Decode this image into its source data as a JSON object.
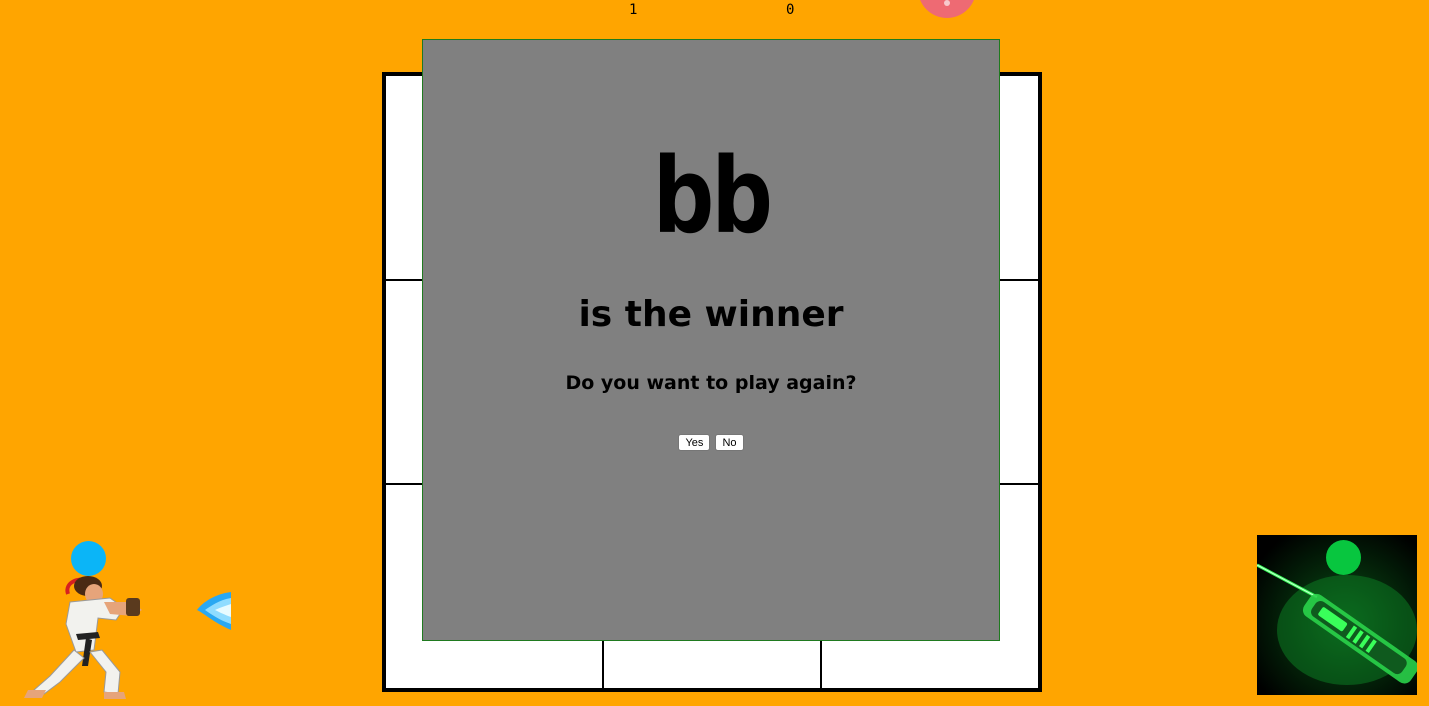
{
  "scoreboard": {
    "player1_score": "1",
    "player2_score": "0"
  },
  "modal": {
    "winner_name": "bb",
    "winner_text": "is the winner",
    "play_again_prompt": "Do you want to play again?",
    "yes_label": "Yes",
    "no_label": "No"
  },
  "board": {
    "cells": [
      "",
      "",
      "",
      "",
      "",
      "",
      "",
      "",
      ""
    ]
  },
  "colors": {
    "background": "#FFA500",
    "modal_background": "#808080",
    "player1_indicator": "#0BB5F7",
    "player2_indicator": "#08C63F",
    "top_marker": "#EE6A73"
  },
  "icons": {
    "player1_avatar": "ryu-fighter-icon",
    "player1_projectile": "hadouken-fireball-icon",
    "player2_avatar": "green-laser-icon"
  }
}
